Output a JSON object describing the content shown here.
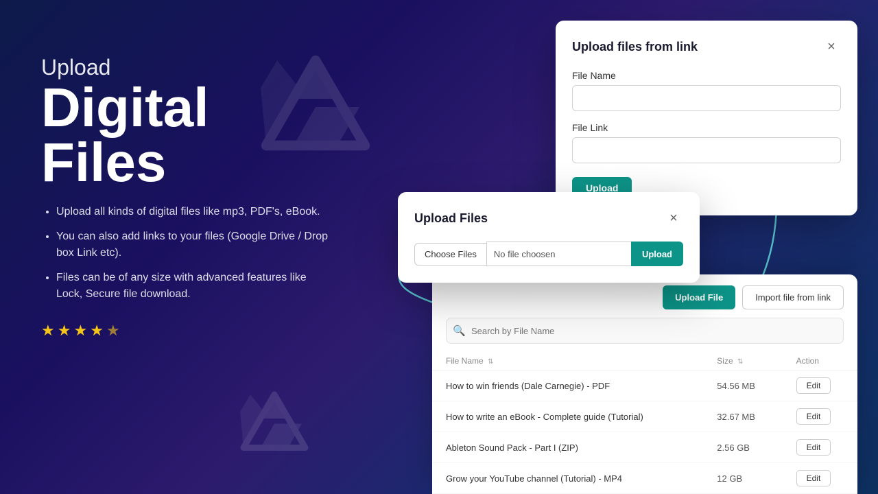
{
  "background": {
    "gradient_start": "#0d1a4a",
    "gradient_end": "#0d3060"
  },
  "left": {
    "upload_label": "Upload",
    "main_title": "Digital\nFiles",
    "bullets": [
      "Upload all kinds of digital files like mp3, PDF's, eBook.",
      "You can also add links to your files (Google Drive / Drop box Link etc).",
      "Files can be of any size with advanced features like Lock, Secure file download."
    ],
    "stars": [
      "★",
      "★",
      "★",
      "★",
      "★"
    ]
  },
  "modal_link": {
    "title": "Upload files from link",
    "close_label": "×",
    "file_name_label": "File Name",
    "file_name_placeholder": "",
    "file_link_label": "File Link",
    "file_link_placeholder": "",
    "upload_button": "Upload"
  },
  "modal_files": {
    "title": "Upload Files",
    "close_label": "×",
    "choose_files_button": "Choose Files",
    "file_name_display": "No file choosen",
    "upload_button": "Upload"
  },
  "file_manager": {
    "upload_file_button": "Upload File",
    "import_link_button": "Import file from link",
    "search_placeholder": "Search by File Name",
    "table": {
      "columns": [
        "File Name",
        "Size",
        "Action"
      ],
      "rows": [
        {
          "name": "How to win friends (Dale Carnegie) - PDF",
          "size": "54.56 MB",
          "action": "Edit"
        },
        {
          "name": "How to write an eBook - Complete guide (Tutorial)",
          "size": "32.67 MB",
          "action": "Edit"
        },
        {
          "name": "Ableton Sound Pack - Part I (ZIP)",
          "size": "2.56 GB",
          "action": "Edit"
        },
        {
          "name": "Grow your YouTube channel (Tutorial) - MP4",
          "size": "12 GB",
          "action": "Edit"
        }
      ]
    }
  }
}
